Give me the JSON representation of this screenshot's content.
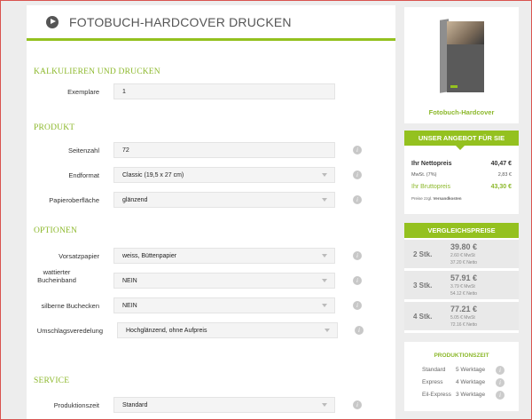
{
  "header": {
    "title": "FOTOBUCH-HARDCOVER DRUCKEN"
  },
  "sections": {
    "calc": "KALKULIEREN UND DRUCKEN",
    "product": "PRODUKT",
    "options": "OPTIONEN",
    "service": "SERVICE"
  },
  "fields": {
    "exemplare": {
      "label": "Exemplare",
      "value": "1"
    },
    "seitenzahl": {
      "label": "Seitenzahl",
      "value": "72"
    },
    "endformat": {
      "label": "Endformat",
      "value": "Classic (19,5 x 27 cm)"
    },
    "papier": {
      "label": "Papieroberfläche",
      "value": "glänzend"
    },
    "vorsatz": {
      "label": "Vorsatzpapier",
      "value": "weiss, Büttenpapier"
    },
    "wattiert": {
      "label": "wattierter Bucheinband",
      "value": "NEIN"
    },
    "buchecken": {
      "label": "silberne Buchecken",
      "value": "NEIN"
    },
    "umschlag": {
      "label": "Umschlagsveredelung",
      "value": "Hochglänzend, ohne Aufpreis"
    },
    "produktionszeit": {
      "label": "Produktionszeit",
      "value": "Standard"
    }
  },
  "product_card": {
    "name": "Fotobuch-Hardcover"
  },
  "offer": {
    "title": "UNSER ANGEBOT FÜR SIE",
    "net_label": "Ihr Nettopreis",
    "net_value": "40,47 €",
    "vat_label": "MwSt. (7%)",
    "vat_value": "2,83 €",
    "gross_label": "Ihr Bruttopreis",
    "gross_value": "43,30 €",
    "note_prefix": "Preise zzgl.",
    "note_link": "Versandkosten"
  },
  "compare": {
    "title": "VERGLEICHSPREISE",
    "rows": [
      {
        "qty": "2 Stk.",
        "price": "39.80 €",
        "vat": "2.60 € MwSt",
        "net": "37.20 € Netto"
      },
      {
        "qty": "3 Stk.",
        "price": "57.91 €",
        "vat": "3.79 € MwSt",
        "net": "54.12 € Netto"
      },
      {
        "qty": "4 Stk.",
        "price": "77.21 €",
        "vat": "5.05 € MwSt",
        "net": "72.16 € Netto"
      }
    ]
  },
  "production": {
    "title": "PRODUKTIONSZEIT",
    "rows": [
      {
        "name": "Standard",
        "days": "5 Werktage"
      },
      {
        "name": "Express",
        "days": "4 Werktage"
      },
      {
        "name": "Eil-Express",
        "days": "3 Werktage"
      }
    ]
  },
  "info_icon": "i",
  "colors": {
    "accent": "#94c11f",
    "accent_text": "#8cb82b"
  }
}
